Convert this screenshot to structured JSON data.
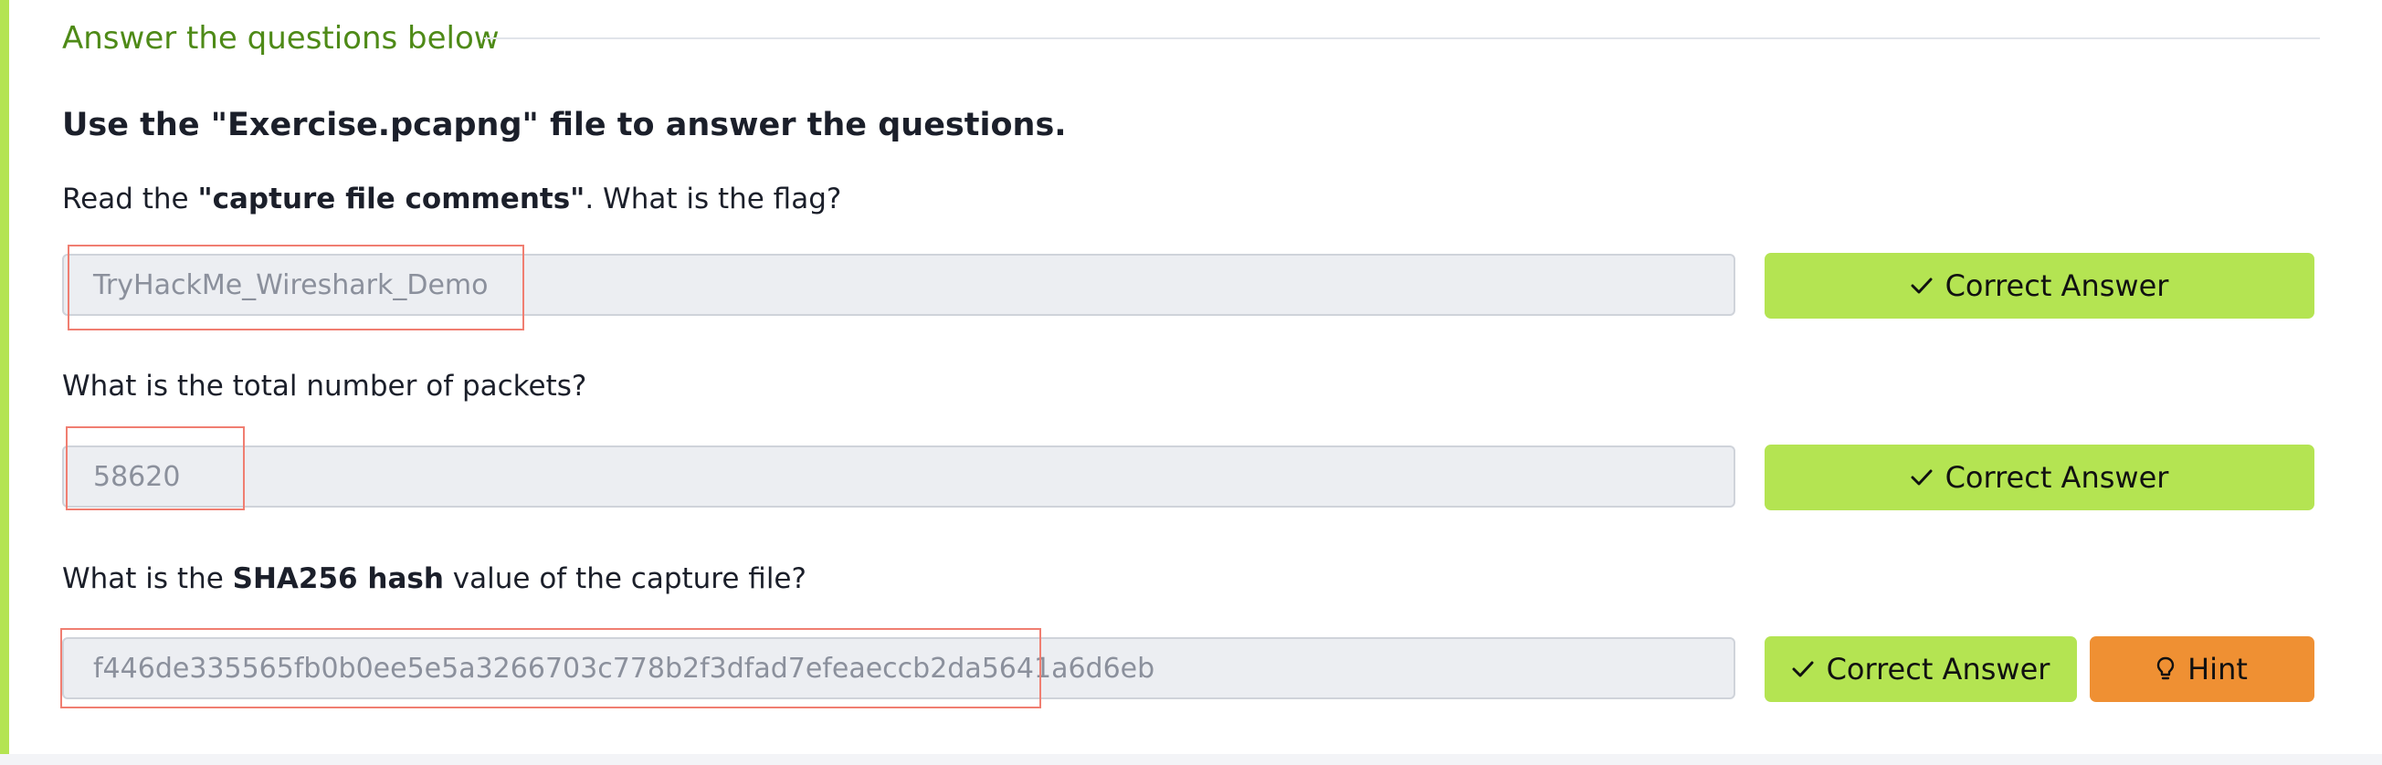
{
  "section": {
    "title": "Answer the questions below"
  },
  "heading": "Use the \"Exercise.pcapng\" file to answer the questions.",
  "questions": [
    {
      "text_before": "Read the ",
      "text_bold": "\"capture file comments\"",
      "text_after": ". What is the flag?",
      "answer": "TryHackMe_Wireshark_Demo",
      "button_label": "Correct Answer"
    },
    {
      "text_before": "What is the total number of packets?",
      "text_bold": "",
      "text_after": "",
      "answer": "58620",
      "button_label": "Correct Answer"
    },
    {
      "text_before": "What is the ",
      "text_bold": "SHA256 hash",
      "text_after": " value of the capture file?",
      "answer": "f446de335565fb0b0ee5e5a3266703c778b2f3dfad7efeaeccb2da5641a6d6eb",
      "button_label": "Correct Answer",
      "hint_label": "Hint"
    }
  ],
  "icons": {
    "check": "check-icon",
    "hint": "lightbulb-icon"
  },
  "colors": {
    "accent_green": "#b4e452",
    "title_green": "#4e8a17",
    "hint_orange": "#ef9033",
    "highlight_red": "#f07e71"
  }
}
